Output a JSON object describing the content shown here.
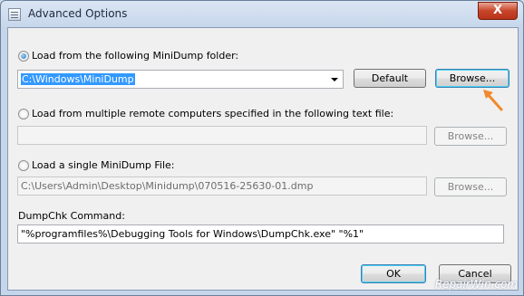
{
  "window": {
    "title": "Advanced Options",
    "close_label": "X"
  },
  "option_folder": {
    "label": "Load from the following MiniDump folder:",
    "value": "C:\\Windows\\MiniDump",
    "default_label": "Default",
    "browse_label": "Browse..."
  },
  "option_remote": {
    "label": "Load from multiple remote computers specified in the following text file:",
    "value": "",
    "browse_label": "Browse..."
  },
  "option_single": {
    "label": "Load a single MiniDump File:",
    "value": "C:\\Users\\Admin\\Desktop\\Minidump\\070516-25630-01.dmp",
    "browse_label": "Browse..."
  },
  "dumpchk": {
    "label": "DumpChk Command:",
    "value": "\"%programfiles%\\Debugging Tools for Windows\\DumpChk.exe\" \"%1\""
  },
  "buttons": {
    "ok_label": "OK",
    "cancel_label": "Cancel"
  },
  "watermark": "RepairWin.com",
  "colors": {
    "accent_arrow": "#f08a2c",
    "selection": "#3399ff"
  }
}
